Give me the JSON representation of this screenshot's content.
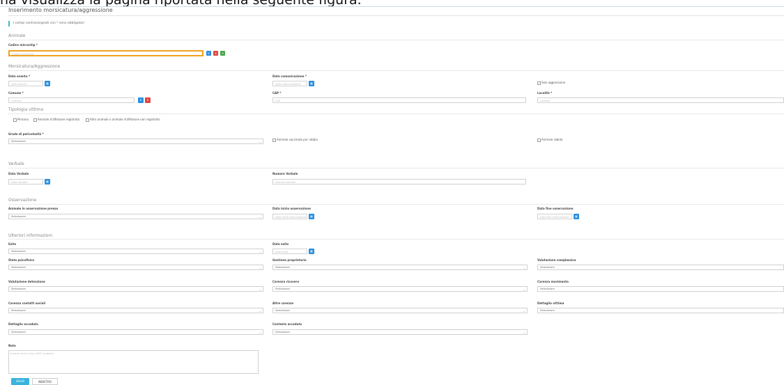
{
  "overlay_text": "ha visualizza la pagina riportata nella seguente figura.",
  "page_title": "Inserimento morsicatura/aggressione",
  "required_note": "I campi contrassegnati con * sono obbligatori",
  "animale": {
    "section": "Animale",
    "microchip_label": "Codice microchip *",
    "microchip_placeholder": "Codice microchip"
  },
  "morsicatura": {
    "section": "Morsicatura/Aggressione",
    "data_evento_label": "Data evento *",
    "data_evento_ph": "Data evento",
    "data_com_label": "Data comunicazione *",
    "data_com_ph": "Data comunicazione",
    "solo_aggressione": "Solo aggressione",
    "comune_label": "Comune *",
    "comune_ph": "Comune",
    "cap_label": "CAP *",
    "cap_ph": "CAP",
    "localita_label": "Località *",
    "localita_ph": "Località"
  },
  "tipologia": {
    "section": "Tipologia vittima",
    "persona": "Persona",
    "animale_reg": "Animale d'affezione registrato",
    "altro_animale": "Altro animale o animale d'affezione non registrato",
    "grado_label": "Grado di pericolosità *",
    "grado_value": "Selezionare",
    "vaccinato": "Animale vaccinato per rabbia",
    "rabido": "Animale rabido"
  },
  "verbale": {
    "section": "Verbale",
    "data_label": "Data Verbale",
    "data_ph": "Data Verbale",
    "numero_label": "Numero Verbale",
    "numero_ph": "Numero Verbale"
  },
  "osservazione": {
    "section": "Osservazione",
    "presso_label": "Animale in osservazione presso",
    "presso_value": "Selezionare",
    "inizio_label": "Data inizio osservazione",
    "inizio_ph": "Data inizio osservazione",
    "fine_label": "Data fine osservazione",
    "fine_ph": "Data fine osservazione"
  },
  "ulteriori": {
    "section": "Ulteriori informazioni",
    "esito_label": "Esito",
    "esito_value": "Selezionare",
    "data_esito_label": "Data esito",
    "data_esito_ph": "Data esito",
    "stato_psico_label": "Stato psicofisico",
    "stato_psico_value": "Selezionare",
    "gestione_label": "Gestione proprietario",
    "gestione_value": "Selezionare",
    "valutazione_label": "Valutazione complessiva",
    "valutazione_value": "Selezionare",
    "detenzione_label": "Valutazione detenzione",
    "detenzione_value": "Selezionare",
    "ricovero_label": "Carenza ricovero",
    "ricovero_value": "Selezionare",
    "movimento_label": "Carenza movimento",
    "movimento_value": "Selezionare",
    "sociali_label": "Carenza contatti sociali",
    "sociali_value": "Selezionare",
    "altre_label": "Altre carenze",
    "altre_value": "Selezionare",
    "vittima_label": "Dettaglio vittima",
    "vittima_value": "Selezionare",
    "dett_accaduto_label": "Dettaglio accaduto",
    "dett_accaduto_value": "Selezionare",
    "contesto_label": "Contesto accaduto",
    "contesto_value": "Selezionare"
  },
  "note": {
    "label": "Note",
    "placeholder": "Inserire testo (max 1000 caratteri)"
  },
  "buttons": {
    "save": "SALVA",
    "back": "INDIETRO"
  }
}
